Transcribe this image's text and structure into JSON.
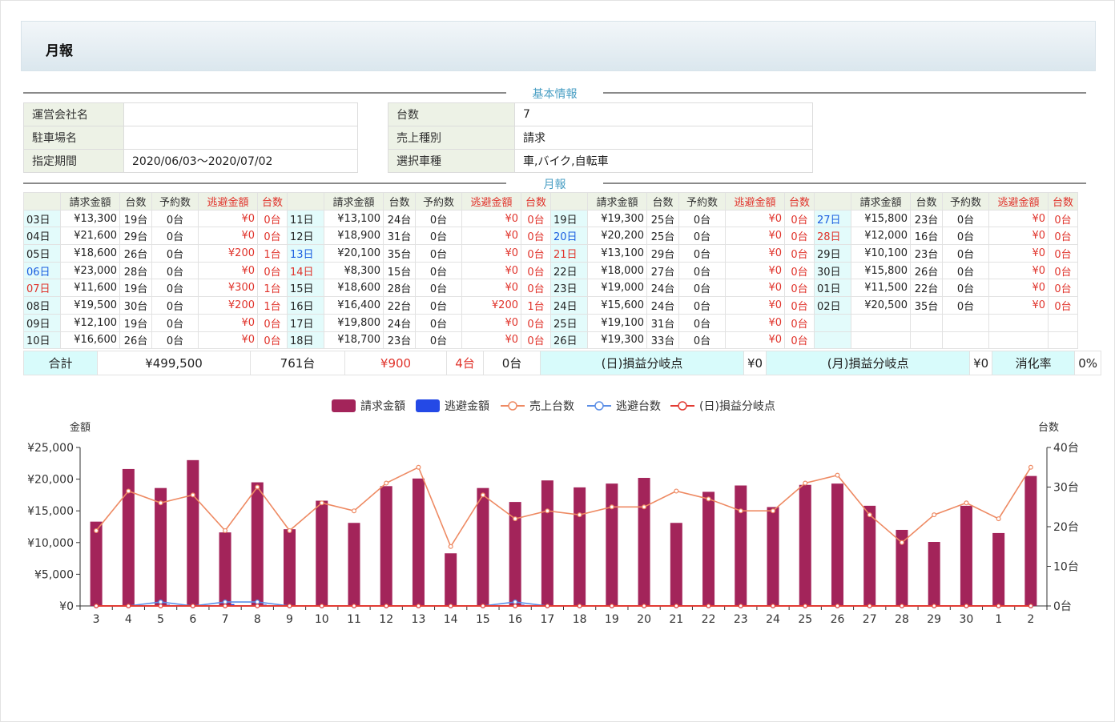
{
  "page": {
    "title": "月報"
  },
  "sections": {
    "basic_info": "基本情報",
    "monthly": "月報"
  },
  "basic_info": {
    "left": [
      {
        "label": "運営会社名",
        "value": ""
      },
      {
        "label": "駐車場名",
        "value": ""
      },
      {
        "label": "指定期間",
        "value": "2020/06/03～2020/07/02"
      }
    ],
    "right": [
      {
        "label": "台数",
        "value": "7"
      },
      {
        "label": "売上種別",
        "value": "請求"
      },
      {
        "label": "選択車種",
        "value": "車,バイク,自転車"
      }
    ]
  },
  "monthly_table": {
    "headers": [
      "",
      "請求金額",
      "台数",
      "予約数",
      "逃避金額",
      "台数"
    ],
    "rows": [
      [
        {
          "day": "03日",
          "dc": "",
          "billing": "¥13,300",
          "units": "19台",
          "reserved": "0台",
          "evasion": "¥0",
          "eunits": "0台"
        },
        {
          "day": "11日",
          "dc": "",
          "billing": "¥13,100",
          "units": "24台",
          "reserved": "0台",
          "evasion": "¥0",
          "eunits": "0台"
        },
        {
          "day": "19日",
          "dc": "",
          "billing": "¥19,300",
          "units": "25台",
          "reserved": "0台",
          "evasion": "¥0",
          "eunits": "0台"
        },
        {
          "day": "27日",
          "dc": "blue",
          "billing": "¥15,800",
          "units": "23台",
          "reserved": "0台",
          "evasion": "¥0",
          "eunits": "0台"
        }
      ],
      [
        {
          "day": "04日",
          "dc": "",
          "billing": "¥21,600",
          "units": "29台",
          "reserved": "0台",
          "evasion": "¥0",
          "eunits": "0台"
        },
        {
          "day": "12日",
          "dc": "",
          "billing": "¥18,900",
          "units": "31台",
          "reserved": "0台",
          "evasion": "¥0",
          "eunits": "0台"
        },
        {
          "day": "20日",
          "dc": "blue",
          "billing": "¥20,200",
          "units": "25台",
          "reserved": "0台",
          "evasion": "¥0",
          "eunits": "0台"
        },
        {
          "day": "28日",
          "dc": "red",
          "billing": "¥12,000",
          "units": "16台",
          "reserved": "0台",
          "evasion": "¥0",
          "eunits": "0台"
        }
      ],
      [
        {
          "day": "05日",
          "dc": "",
          "billing": "¥18,600",
          "units": "26台",
          "reserved": "0台",
          "evasion": "¥200",
          "eunits": "1台"
        },
        {
          "day": "13日",
          "dc": "blue",
          "billing": "¥20,100",
          "units": "35台",
          "reserved": "0台",
          "evasion": "¥0",
          "eunits": "0台"
        },
        {
          "day": "21日",
          "dc": "red",
          "billing": "¥13,100",
          "units": "29台",
          "reserved": "0台",
          "evasion": "¥0",
          "eunits": "0台"
        },
        {
          "day": "29日",
          "dc": "",
          "billing": "¥10,100",
          "units": "23台",
          "reserved": "0台",
          "evasion": "¥0",
          "eunits": "0台"
        }
      ],
      [
        {
          "day": "06日",
          "dc": "blue",
          "billing": "¥23,000",
          "units": "28台",
          "reserved": "0台",
          "evasion": "¥0",
          "eunits": "0台"
        },
        {
          "day": "14日",
          "dc": "red",
          "billing": "¥8,300",
          "units": "15台",
          "reserved": "0台",
          "evasion": "¥0",
          "eunits": "0台"
        },
        {
          "day": "22日",
          "dc": "",
          "billing": "¥18,000",
          "units": "27台",
          "reserved": "0台",
          "evasion": "¥0",
          "eunits": "0台"
        },
        {
          "day": "30日",
          "dc": "",
          "billing": "¥15,800",
          "units": "26台",
          "reserved": "0台",
          "evasion": "¥0",
          "eunits": "0台"
        }
      ],
      [
        {
          "day": "07日",
          "dc": "red",
          "billing": "¥11,600",
          "units": "19台",
          "reserved": "0台",
          "evasion": "¥300",
          "eunits": "1台"
        },
        {
          "day": "15日",
          "dc": "",
          "billing": "¥18,600",
          "units": "28台",
          "reserved": "0台",
          "evasion": "¥0",
          "eunits": "0台"
        },
        {
          "day": "23日",
          "dc": "",
          "billing": "¥19,000",
          "units": "24台",
          "reserved": "0台",
          "evasion": "¥0",
          "eunits": "0台"
        },
        {
          "day": "01日",
          "dc": "",
          "billing": "¥11,500",
          "units": "22台",
          "reserved": "0台",
          "evasion": "¥0",
          "eunits": "0台"
        }
      ],
      [
        {
          "day": "08日",
          "dc": "",
          "billing": "¥19,500",
          "units": "30台",
          "reserved": "0台",
          "evasion": "¥200",
          "eunits": "1台"
        },
        {
          "day": "16日",
          "dc": "",
          "billing": "¥16,400",
          "units": "22台",
          "reserved": "0台",
          "evasion": "¥200",
          "eunits": "1台"
        },
        {
          "day": "24日",
          "dc": "",
          "billing": "¥15,600",
          "units": "24台",
          "reserved": "0台",
          "evasion": "¥0",
          "eunits": "0台"
        },
        {
          "day": "02日",
          "dc": "",
          "billing": "¥20,500",
          "units": "35台",
          "reserved": "0台",
          "evasion": "¥0",
          "eunits": "0台"
        }
      ],
      [
        {
          "day": "09日",
          "dc": "",
          "billing": "¥12,100",
          "units": "19台",
          "reserved": "0台",
          "evasion": "¥0",
          "eunits": "0台"
        },
        {
          "day": "17日",
          "dc": "",
          "billing": "¥19,800",
          "units": "24台",
          "reserved": "0台",
          "evasion": "¥0",
          "eunits": "0台"
        },
        {
          "day": "25日",
          "dc": "",
          "billing": "¥19,100",
          "units": "31台",
          "reserved": "0台",
          "evasion": "¥0",
          "eunits": "0台"
        },
        {
          "day": "",
          "dc": "",
          "billing": "",
          "units": "",
          "reserved": "",
          "evasion": "",
          "eunits": ""
        }
      ],
      [
        {
          "day": "10日",
          "dc": "",
          "billing": "¥16,600",
          "units": "26台",
          "reserved": "0台",
          "evasion": "¥0",
          "eunits": "0台"
        },
        {
          "day": "18日",
          "dc": "",
          "billing": "¥18,700",
          "units": "23台",
          "reserved": "0台",
          "evasion": "¥0",
          "eunits": "0台"
        },
        {
          "day": "26日",
          "dc": "",
          "billing": "¥19,300",
          "units": "33台",
          "reserved": "0台",
          "evasion": "¥0",
          "eunits": "0台"
        },
        {
          "day": "",
          "dc": "",
          "billing": "",
          "units": "",
          "reserved": "",
          "evasion": "",
          "eunits": ""
        }
      ]
    ]
  },
  "totals": {
    "label": "合計",
    "billing": "¥499,500",
    "units": "761台",
    "evasion": "¥900",
    "evasion_units": "4台",
    "reserved": "0台",
    "daily_breakeven_label": "(日)損益分岐点",
    "daily_breakeven_value": "¥0",
    "monthly_breakeven_label": "(月)損益分岐点",
    "monthly_breakeven_value": "¥0",
    "consumption_label": "消化率",
    "consumption_value": "0%"
  },
  "colors": {
    "billing_bar": "#a3245a",
    "evasion_bar": "#2449e6",
    "sales_units_line": "#ee8a63",
    "evasion_units_line": "#5b8ee6",
    "daily_breakeven_line": "#e23b33",
    "header_red": "#e0332b",
    "day_blue": "#1a5ee0"
  },
  "chart_data": {
    "type": "bar",
    "categories": [
      "3",
      "4",
      "5",
      "6",
      "7",
      "8",
      "9",
      "10",
      "11",
      "12",
      "13",
      "14",
      "15",
      "16",
      "17",
      "18",
      "19",
      "20",
      "21",
      "22",
      "23",
      "24",
      "25",
      "26",
      "27",
      "28",
      "29",
      "30",
      "1",
      "2"
    ],
    "legend": [
      "請求金額",
      "逃避金額",
      "売上台数",
      "逃避台数",
      "(日)損益分岐点"
    ],
    "legend_position": "top",
    "ylabel": "金額",
    "ylabel_right": "台数",
    "ylim": [
      0,
      25000
    ],
    "ylim_right": [
      0,
      40
    ],
    "yticks": [
      "¥0",
      "¥5,000",
      "¥10,000",
      "¥15,000",
      "¥20,000",
      "¥25,000"
    ],
    "yticks_right": [
      "0台",
      "10台",
      "20台",
      "30台",
      "40台"
    ],
    "series": [
      {
        "name": "請求金額",
        "kind": "bar",
        "axis": "left",
        "values": [
          13300,
          21600,
          18600,
          23000,
          11600,
          19500,
          12100,
          16600,
          13100,
          18900,
          20100,
          8300,
          18600,
          16400,
          19800,
          18700,
          19300,
          20200,
          13100,
          18000,
          19000,
          15600,
          19100,
          19300,
          15800,
          12000,
          10100,
          15800,
          11500,
          20500
        ]
      },
      {
        "name": "逃避金額",
        "kind": "bar",
        "axis": "left",
        "values": [
          0,
          0,
          200,
          0,
          300,
          200,
          0,
          0,
          0,
          0,
          0,
          0,
          0,
          200,
          0,
          0,
          0,
          0,
          0,
          0,
          0,
          0,
          0,
          0,
          0,
          0,
          0,
          0,
          0,
          0
        ]
      },
      {
        "name": "売上台数",
        "kind": "line",
        "axis": "right",
        "values": [
          19,
          29,
          26,
          28,
          19,
          30,
          19,
          26,
          24,
          31,
          35,
          15,
          28,
          22,
          24,
          23,
          25,
          25,
          29,
          27,
          24,
          24,
          31,
          33,
          23,
          16,
          23,
          26,
          22,
          35
        ]
      },
      {
        "name": "逃避台数",
        "kind": "line",
        "axis": "right",
        "values": [
          0,
          0,
          1,
          0,
          1,
          1,
          0,
          0,
          0,
          0,
          0,
          0,
          0,
          1,
          0,
          0,
          0,
          0,
          0,
          0,
          0,
          0,
          0,
          0,
          0,
          0,
          0,
          0,
          0,
          0
        ]
      },
      {
        "name": "(日)損益分岐点",
        "kind": "line",
        "axis": "right",
        "values": [
          0,
          0,
          0,
          0,
          0,
          0,
          0,
          0,
          0,
          0,
          0,
          0,
          0,
          0,
          0,
          0,
          0,
          0,
          0,
          0,
          0,
          0,
          0,
          0,
          0,
          0,
          0,
          0,
          0,
          0
        ]
      }
    ]
  }
}
